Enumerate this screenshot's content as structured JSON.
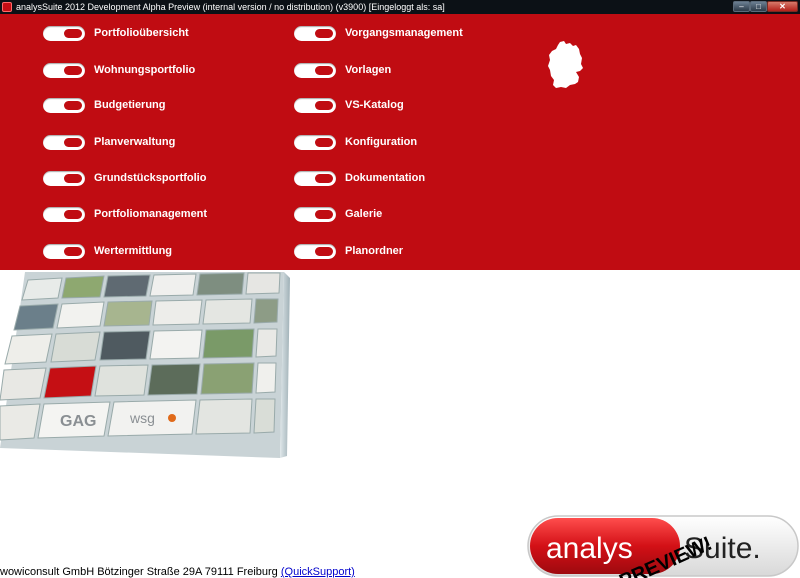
{
  "window": {
    "title": "analysSuite 2012 Development Alpha Preview (internal version / no distribution) (v3900)  [Eingeloggt als: sa]",
    "minimize_icon": "minimize-icon",
    "maximize_icon": "maximize-icon",
    "close_icon": "close-icon"
  },
  "menu": {
    "left": [
      {
        "label": "Portfolioübersicht"
      },
      {
        "label": "Wohnungsportfolio"
      },
      {
        "label": "Budgetierung"
      },
      {
        "label": "Planverwaltung"
      },
      {
        "label": "Grundstücksportfolio"
      },
      {
        "label": "Portfoliomanagement"
      },
      {
        "label": "Wertermittlung"
      }
    ],
    "right": [
      {
        "label": "Vorgangsmanagement"
      },
      {
        "label": "Vorlagen"
      },
      {
        "label": "VS-Katalog"
      },
      {
        "label": "Konfiguration"
      },
      {
        "label": "Dokumentation"
      },
      {
        "label": "Galerie"
      },
      {
        "label": "Planordner"
      }
    ]
  },
  "brand_color": "#c00c12",
  "collage": {
    "tile_logos": [
      "GAG",
      "wsg"
    ]
  },
  "footer": {
    "company": "wowiconsult GmbH Bötzinger Straße 29A 79111 Freiburg",
    "support_link": "(QuickSupport)"
  },
  "logo": {
    "left_text": "analys",
    "right_text": "Suite.",
    "overlay_text": "PREVIEW!"
  }
}
